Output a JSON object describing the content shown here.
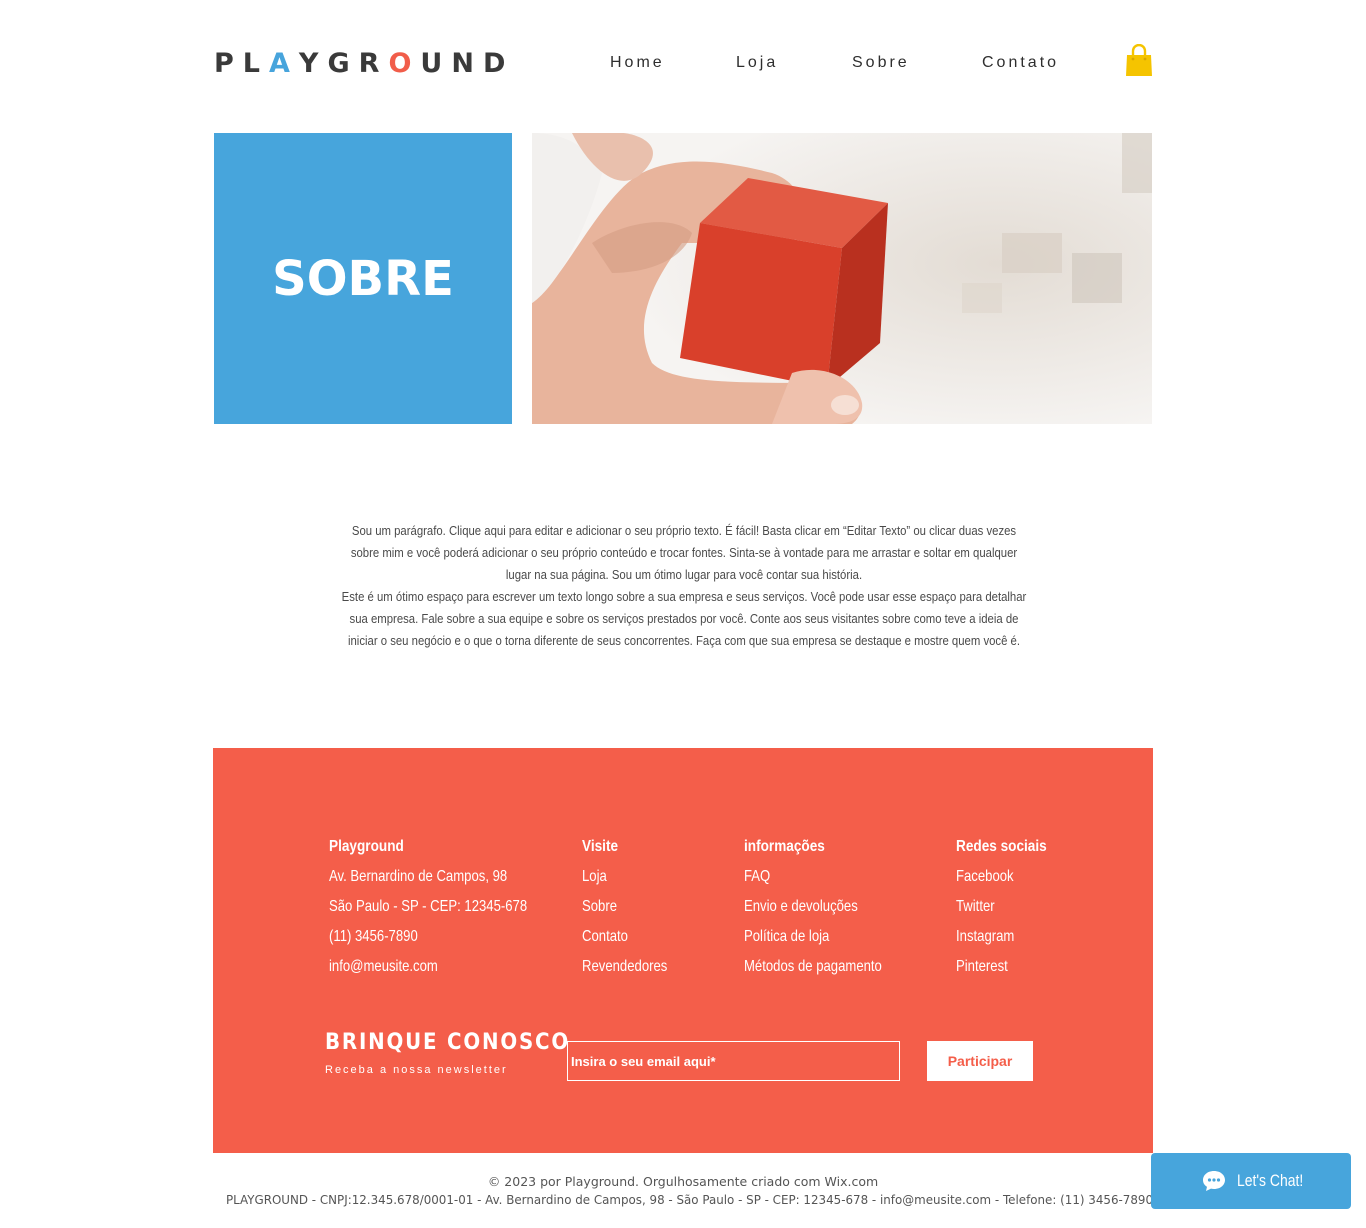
{
  "brand": {
    "letters": [
      {
        "ch": "P",
        "tone": "dark"
      },
      {
        "ch": "L",
        "tone": "dark"
      },
      {
        "ch": "A",
        "tone": "blue"
      },
      {
        "ch": "Y",
        "tone": "dark"
      },
      {
        "ch": "G",
        "tone": "dark"
      },
      {
        "ch": "R",
        "tone": "dark"
      },
      {
        "ch": "O",
        "tone": "red"
      },
      {
        "ch": "U",
        "tone": "dark"
      },
      {
        "ch": "N",
        "tone": "dark"
      },
      {
        "ch": "D",
        "tone": "dark"
      }
    ]
  },
  "nav": {
    "home": "Home",
    "loja": "Loja",
    "sobre": "Sobre",
    "contato": "Contato"
  },
  "cart": {
    "icon": "shopping-bag-icon",
    "color": "#f5c400"
  },
  "hero": {
    "title": "SOBRE",
    "box_color": "#47a5dc"
  },
  "about": {
    "p1": "Sou um parágrafo. Clique aqui para editar e adicionar o seu próprio texto. É fácil! Basta clicar em “Editar Texto” ou clicar duas vezes sobre mim e você poderá adicionar o seu próprio conteúdo e trocar fontes. Sinta-se à vontade para me arrastar e soltar em qualquer lugar na sua página. Sou um ótimo lugar para você contar sua história.",
    "p2": "Este é um ótimo espaço para escrever um texto longo sobre a sua empresa e seus serviços. Você pode usar esse espaço para detalhar sua empresa. Fale sobre a sua equipe e sobre os serviços prestados por você. Conte aos seus visitantes sobre como teve a ideia de iniciar o seu negócio e o que o torna diferente de seus concorrentes. Faça com que sua empresa se destaque e mostre quem você é."
  },
  "footer": {
    "bg_color": "#f45e4a",
    "col1": {
      "head": "Playground",
      "items": [
        "Av. Bernardino de Campos, 98",
        "São Paulo - SP - CEP: 12345-678",
        "(11) 3456-7890",
        "info@meusite.com"
      ]
    },
    "col2": {
      "head": "Visite",
      "items": [
        "Loja",
        "Sobre",
        "Contato",
        "Revendedores"
      ]
    },
    "col3": {
      "head": "informações",
      "items": [
        "FAQ",
        "Envio e devoluções",
        "Política de loja",
        "Métodos de pagamento"
      ]
    },
    "col4": {
      "head": "Redes sociais",
      "items": [
        "Facebook",
        "Twitter",
        "Instagram",
        "Pinterest"
      ]
    },
    "newsletter": {
      "title": "BRINQUE CONOSCO",
      "subtitle": "Receba a nossa newsletter",
      "placeholder": "Insira o seu email aqui*",
      "button": "Participar"
    }
  },
  "credits": {
    "line1": "© 2023 por Playground. Orgulhosamente criado com Wix.com",
    "line2": "PLAYGROUND - CNPJ:12.345.678/0001-01 - Av. Bernardino de Campos, 98 - São Paulo - SP - CEP: 12345-678 - info@meusite.com - Telefone: (11) 3456-7890"
  },
  "chat": {
    "label": "Let's Chat!",
    "icon": "chat-bubble-icon",
    "color": "#47a5dc"
  }
}
